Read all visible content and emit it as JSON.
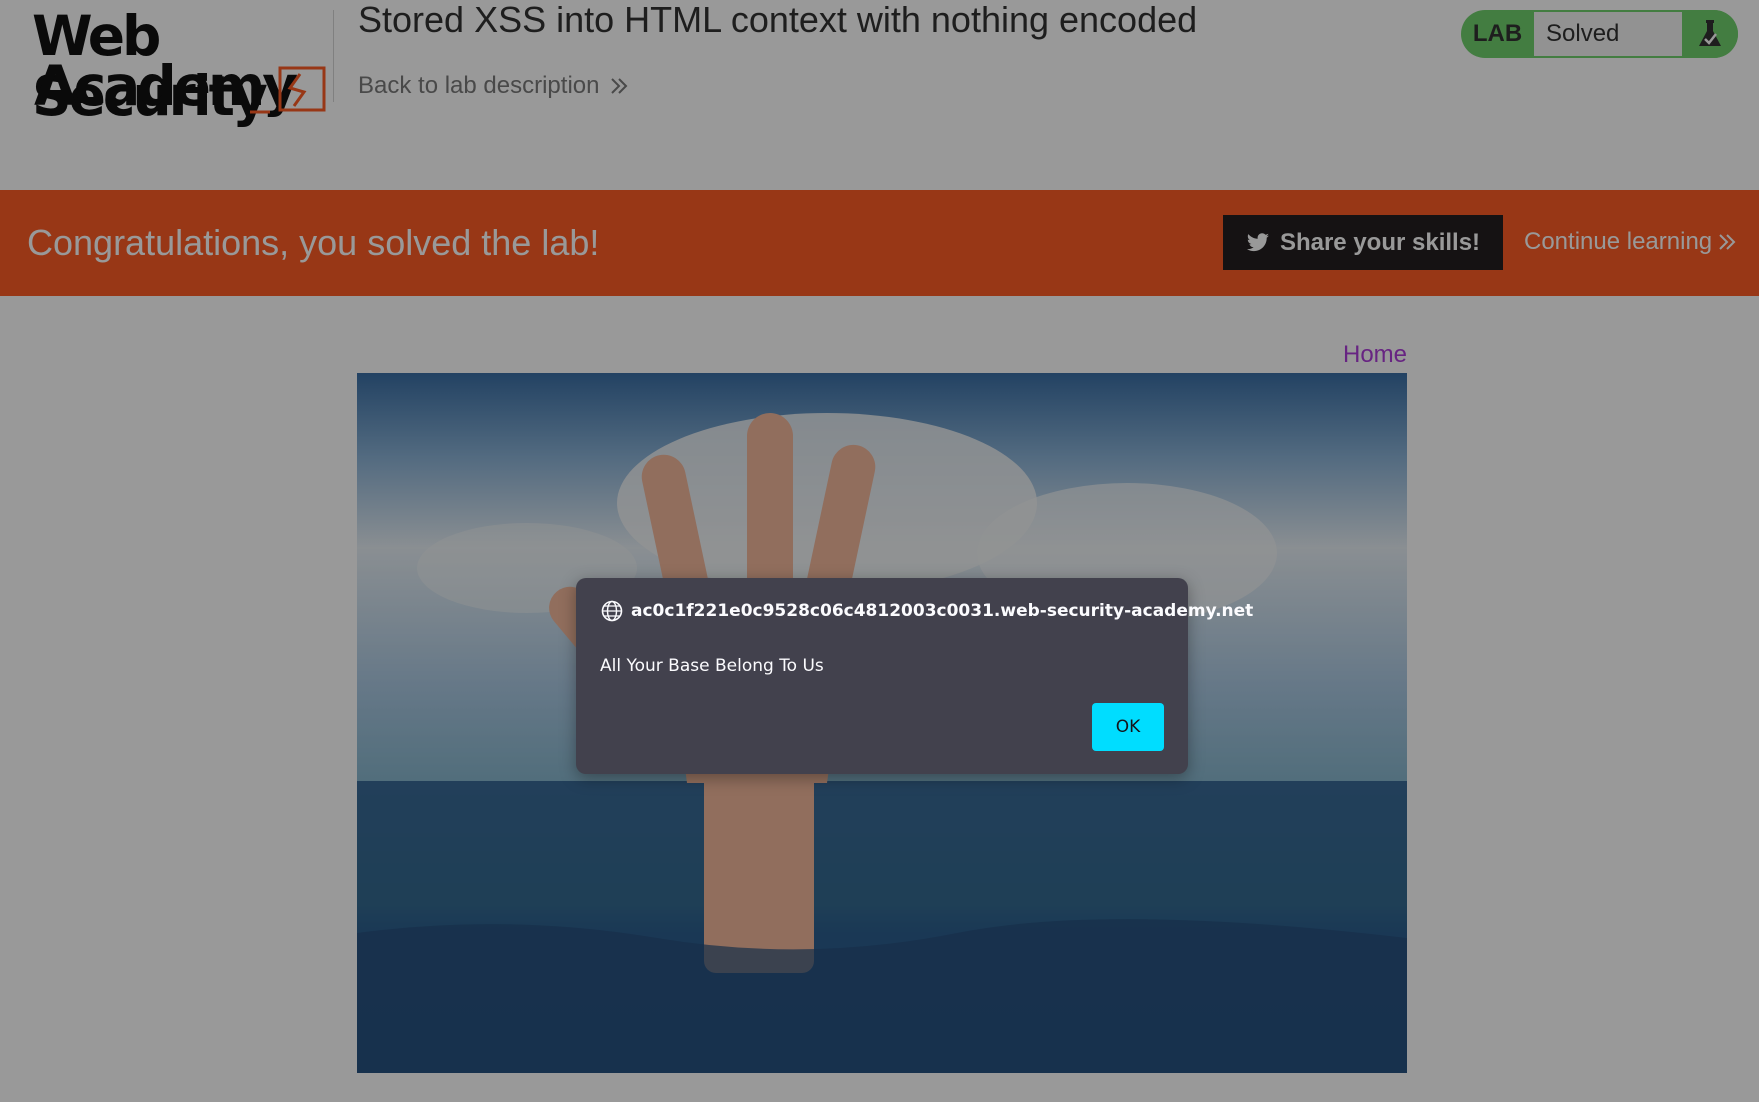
{
  "header": {
    "logo_line1": "Web Security",
    "logo_line2": "Academy",
    "lab_title": "Stored XSS into HTML context with nothing encoded",
    "back_link": "Back to lab description",
    "status": {
      "tag": "LAB",
      "value": "Solved"
    }
  },
  "banner": {
    "message": "Congratulations, you solved the lab!",
    "share_button": "Share your skills!",
    "continue_link": "Continue learning"
  },
  "nav": {
    "home_link": "Home"
  },
  "dialog": {
    "origin": "ac0c1f221e0c9528c06c4812003c0031.web-security-academy.net",
    "message": "All Your Base Belong To Us",
    "ok_button": "OK"
  },
  "colors": {
    "banner": "#fd5d26",
    "status_solved": "#70d16d",
    "home_link": "#ac3cd9",
    "dialog_bg": "#42414d",
    "dialog_ok": "#00ddff"
  }
}
